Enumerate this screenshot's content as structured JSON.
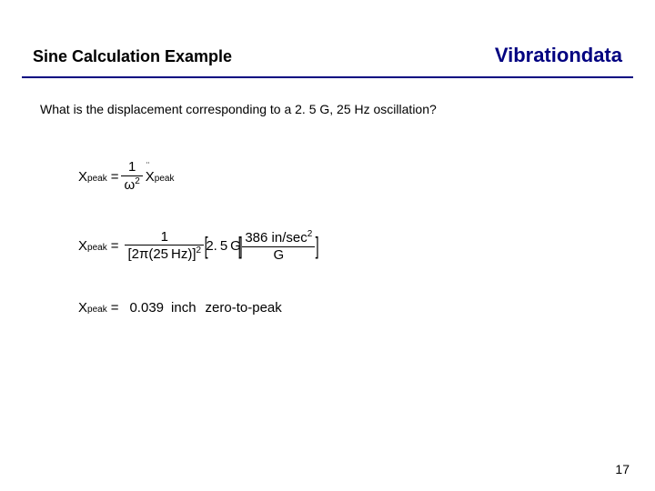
{
  "header": {
    "left": "Sine Calculation Example",
    "right": "Vibrationdata"
  },
  "question": "What is the displacement corresponding to a 2. 5 G, 25 Hz oscillation?",
  "eq": {
    "x_label": "X",
    "peak_sub": "peak",
    "eq_sign": "=",
    "frac1_num": "1",
    "frac1_den_base": "ω",
    "frac1_den_exp": "2",
    "ddot": "¨",
    "line2_denom": "[2π(25 Hz)]",
    "line2_denom_exp": "2",
    "line2_brak_val": "2. 5 G",
    "line2_unit_num_a": "386",
    "line2_unit_num_b": "in/sec",
    "line2_unit_num_exp": "2",
    "line2_unit_den": "G",
    "line3_val": "0.039",
    "line3_unit": "inch",
    "line3_qual": "zero-to-peak"
  },
  "page_number": "17"
}
